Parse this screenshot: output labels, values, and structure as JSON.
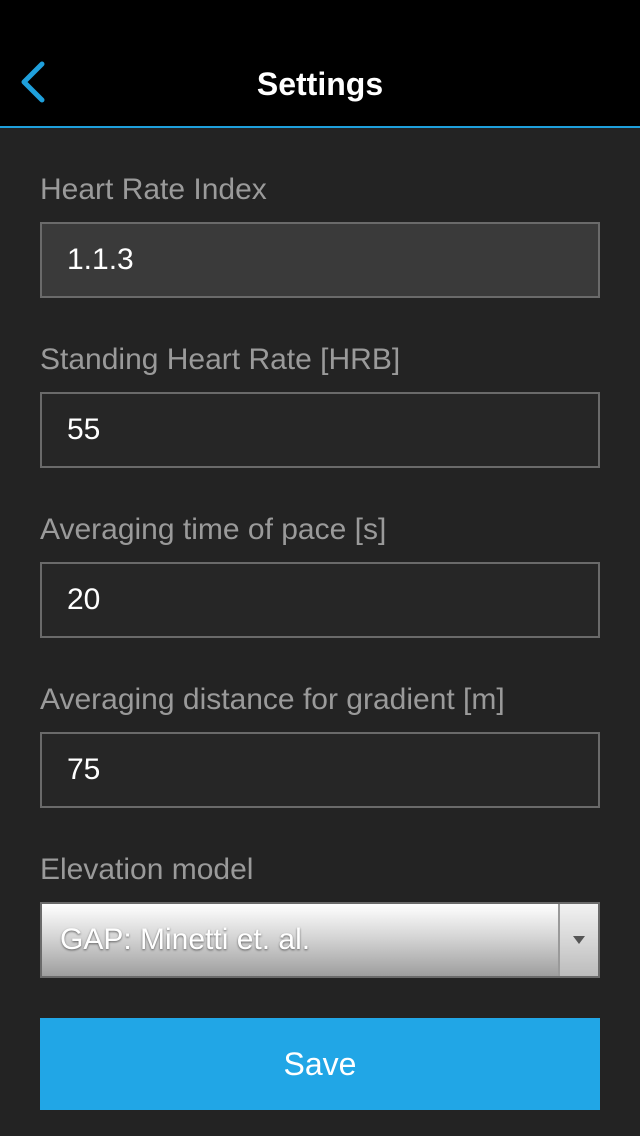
{
  "header": {
    "title": "Settings",
    "back_icon": "chevron-left-icon",
    "accent_color": "#1fa0dc"
  },
  "fields": {
    "heart_rate_index": {
      "label": "Heart Rate Index",
      "value": "1.1.3"
    },
    "standing_heart_rate": {
      "label": "Standing Heart Rate [HRB]",
      "value": "55"
    },
    "averaging_time_pace": {
      "label": "Averaging time of pace [s]",
      "value": "20"
    },
    "averaging_distance_gradient": {
      "label": "Averaging distance for gradient [m]",
      "value": "75"
    },
    "elevation_model": {
      "label": "Elevation model",
      "selected": "GAP: Minetti et. al."
    }
  },
  "save_button": {
    "label": "Save",
    "color": "#21a6e6"
  }
}
